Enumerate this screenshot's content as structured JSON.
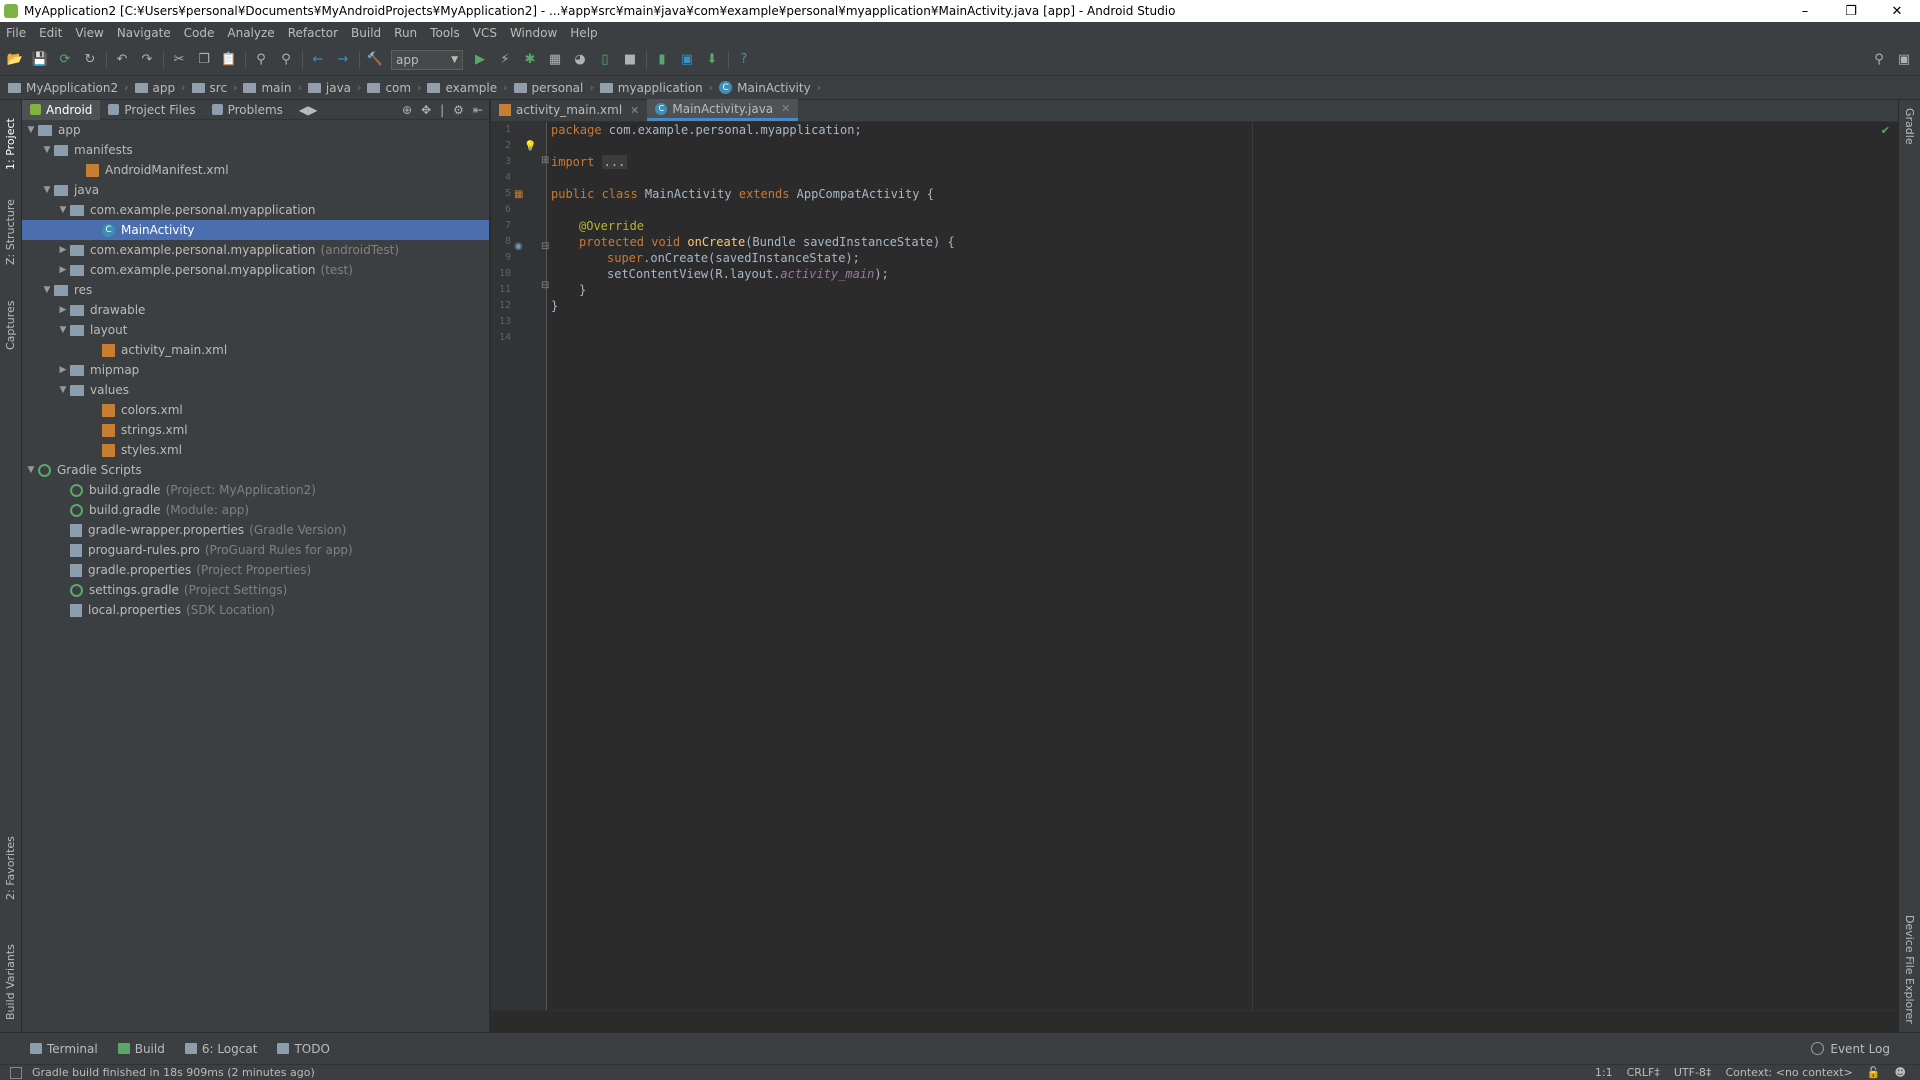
{
  "window": {
    "title": "MyApplication2 [C:¥Users¥personal¥Documents¥MyAndroidProjects¥MyApplication2] - ...¥app¥src¥main¥java¥com¥example¥personal¥myapplication¥MainActivity.java [app] - Android Studio",
    "minimize": "–",
    "maximize": "❐",
    "close": "✕"
  },
  "menu": [
    "File",
    "Edit",
    "View",
    "Navigate",
    "Code",
    "Analyze",
    "Refactor",
    "Build",
    "Run",
    "Tools",
    "VCS",
    "Window",
    "Help"
  ],
  "toolbar": {
    "run_config": "app",
    "help": "?"
  },
  "breadcrumb": [
    "MyApplication2",
    "app",
    "src",
    "main",
    "java",
    "com",
    "example",
    "personal",
    "myapplication",
    "MainActivity"
  ],
  "left_strip": {
    "project": "1: Project",
    "structure": "Z: Structure",
    "captures": "Captures",
    "favorites": "2: Favorites",
    "build_variants": "Build Variants"
  },
  "right_strip": {
    "gradle": "Gradle",
    "device_file_explorer": "Device File Explorer"
  },
  "project_panel": {
    "tabs": [
      "Android",
      "Project Files",
      "Problems"
    ],
    "tree": [
      {
        "label": "app",
        "extra": "",
        "depth": 0,
        "toggle": "▼",
        "icon": "folder"
      },
      {
        "label": "manifests",
        "extra": "",
        "depth": 1,
        "toggle": "▼",
        "icon": "folder"
      },
      {
        "label": "AndroidManifest.xml",
        "extra": "",
        "depth": 3,
        "toggle": "",
        "icon": "xml"
      },
      {
        "label": "java",
        "extra": "",
        "depth": 1,
        "toggle": "▼",
        "icon": "folder"
      },
      {
        "label": "com.example.personal.myapplication",
        "extra": "",
        "depth": 2,
        "toggle": "▼",
        "icon": "folder"
      },
      {
        "label": "MainActivity",
        "extra": "",
        "depth": 4,
        "toggle": "",
        "icon": "class"
      },
      {
        "label": "com.example.personal.myapplication",
        "extra": "(androidTest)",
        "depth": 2,
        "toggle": "▶",
        "icon": "folder"
      },
      {
        "label": "com.example.personal.myapplication",
        "extra": "(test)",
        "depth": 2,
        "toggle": "▶",
        "icon": "folder"
      },
      {
        "label": "res",
        "extra": "",
        "depth": 1,
        "toggle": "▼",
        "icon": "folder"
      },
      {
        "label": "drawable",
        "extra": "",
        "depth": 2,
        "toggle": "▶",
        "icon": "folder"
      },
      {
        "label": "layout",
        "extra": "",
        "depth": 2,
        "toggle": "▼",
        "icon": "folder"
      },
      {
        "label": "activity_main.xml",
        "extra": "",
        "depth": 4,
        "toggle": "",
        "icon": "xml"
      },
      {
        "label": "mipmap",
        "extra": "",
        "depth": 2,
        "toggle": "▶",
        "icon": "folder"
      },
      {
        "label": "values",
        "extra": "",
        "depth": 2,
        "toggle": "▼",
        "icon": "folder"
      },
      {
        "label": "colors.xml",
        "extra": "",
        "depth": 4,
        "toggle": "",
        "icon": "xml"
      },
      {
        "label": "strings.xml",
        "extra": "",
        "depth": 4,
        "toggle": "",
        "icon": "xml"
      },
      {
        "label": "styles.xml",
        "extra": "",
        "depth": 4,
        "toggle": "",
        "icon": "xml"
      },
      {
        "label": "Gradle Scripts",
        "extra": "",
        "depth": 0,
        "toggle": "▼",
        "icon": "gradle"
      },
      {
        "label": "build.gradle",
        "extra": "(Project: MyApplication2)",
        "depth": 2,
        "toggle": "",
        "icon": "gradle"
      },
      {
        "label": "build.gradle",
        "extra": "(Module: app)",
        "depth": 2,
        "toggle": "",
        "icon": "gradle"
      },
      {
        "label": "gradle-wrapper.properties",
        "extra": "(Gradle Version)",
        "depth": 2,
        "toggle": "",
        "icon": "props"
      },
      {
        "label": "proguard-rules.pro",
        "extra": "(ProGuard Rules for app)",
        "depth": 2,
        "toggle": "",
        "icon": "props"
      },
      {
        "label": "gradle.properties",
        "extra": "(Project Properties)",
        "depth": 2,
        "toggle": "",
        "icon": "props"
      },
      {
        "label": "settings.gradle",
        "extra": "(Project Settings)",
        "depth": 2,
        "toggle": "",
        "icon": "gradle"
      },
      {
        "label": "local.properties",
        "extra": "(SDK Location)",
        "depth": 2,
        "toggle": "",
        "icon": "props"
      }
    ],
    "selected": "MainActivity"
  },
  "editor": {
    "tabs": [
      {
        "label": "activity_main.xml",
        "active": false
      },
      {
        "label": "MainActivity.java",
        "active": true
      }
    ],
    "line_numbers": [
      "1",
      "2",
      "3",
      "4",
      "5",
      "6",
      "7",
      "8",
      "9",
      "10",
      "11",
      "12",
      "13",
      "14"
    ],
    "lines": {
      "l1_kw": "package",
      "l1_rest": " com.example.personal.myapplication;",
      "l3_kw": "import",
      "l3_fold": "...",
      "l6_kw": "public class",
      "l6_name": " MainActivity ",
      "l6_ext": "extends",
      "l6_rest": " AppCompatActivity {",
      "l8_an": "@Override",
      "l9_kw": "protected void",
      "l9_fn": " onCreate",
      "l9_rest": "(Bundle savedInstanceState) {",
      "l10_kw": "super",
      "l10_rest": ".onCreate(savedInstanceState);",
      "l11_a": "setContentView(R.layout.",
      "l11_it": "activity_main",
      "l11_b": ");",
      "l12": "}",
      "l13": "}"
    }
  },
  "bottom_tools": [
    "Terminal",
    "Build",
    "6: Logcat",
    "TODO"
  ],
  "event_log": "Event Log",
  "status": {
    "message": "Gradle build finished in 18s 909ms (2 minutes ago)",
    "position": "1:1",
    "line_sep": "CRLF‡",
    "encoding": "UTF-8‡",
    "context": "Context: <no context>"
  },
  "colors": {
    "accent": "#4b6eaf",
    "keyword": "#cc7832",
    "annotation": "#bbb529",
    "function": "#ffc66d"
  }
}
